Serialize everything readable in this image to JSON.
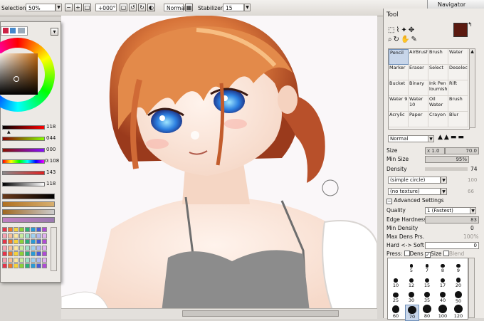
{
  "toolbar": {
    "selection_label": "Selection",
    "zoom_value": "50%",
    "angle_value": "+000°",
    "blend_mode": "Normal",
    "stabilizer_label": "Stabilizer",
    "stabilizer_value": "15"
  },
  "navigator": {
    "title": "Navigator"
  },
  "color_panel": {
    "slider_values": [
      "118",
      "044",
      "000",
      "0:108",
      "143",
      "118"
    ],
    "hue_color": "#5a2a1a"
  },
  "tool_panel": {
    "title": "Tool",
    "primary_color": "#5b1a10",
    "secondary_color": "#e07a6a",
    "tools": [
      [
        "Pencil",
        "AirBrush",
        "Brush",
        "Water"
      ],
      [
        "Marker",
        "Eraser",
        "Select",
        "Deselect"
      ],
      [
        "Bucket",
        "Binary",
        "Ink Pen loumish",
        "Rift"
      ],
      [
        "Water 9",
        "Water 10",
        "Oil Water",
        "Brush"
      ],
      [
        "Acrylic",
        "Paper",
        "Crayon",
        "Blur"
      ]
    ],
    "blend_mode": "Normal",
    "size_label": "Size",
    "size_multiplier": "x 1.0",
    "size_value": "70.0",
    "min_size_label": "Min Size",
    "min_size_value": "95%",
    "density_label": "Density",
    "density_value": "74",
    "shape_select": "(simple circle)",
    "shape_value": "100",
    "texture_select": "(no texture)",
    "texture_value": "66",
    "advanced_label": "Advanced Settings",
    "quality_label": "Quality",
    "quality_value": "1 (Fastest)",
    "edge_hardness_label": "Edge Hardness",
    "edge_hardness_value": "83",
    "min_density_label": "Min Density",
    "min_density_value": "0",
    "max_dens_label": "Max Dens Prs.",
    "max_dens_value": "100%",
    "hard_soft_label": "Hard <-> Soft",
    "hard_soft_value": "0",
    "press_label": "Press:",
    "press_dens": "Dens",
    "press_size": "Size",
    "press_blend": "Blend",
    "brush_sizes": [
      [
        "5",
        "7",
        "8",
        "9"
      ],
      [
        "10",
        "12",
        "15",
        "17",
        "20"
      ],
      [
        "25",
        "30",
        "35",
        "40",
        "50"
      ],
      [
        "60",
        "70",
        "80",
        "100",
        "120"
      ]
    ]
  }
}
